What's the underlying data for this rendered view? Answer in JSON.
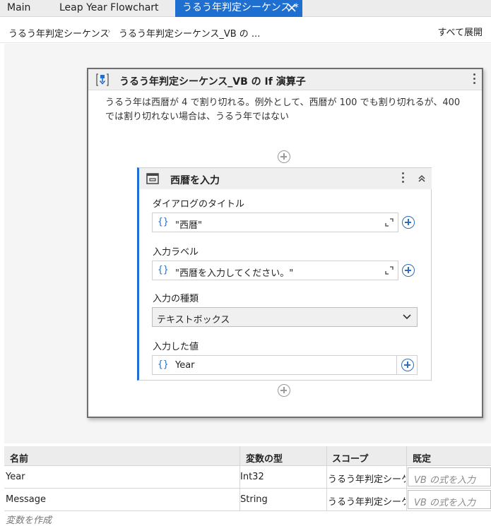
{
  "tabs": [
    {
      "label": "Main",
      "active": false
    },
    {
      "label": "Leap Year Flowchart",
      "active": false
    },
    {
      "label": "うるう年判定シーケンス *",
      "active": true
    }
  ],
  "breadcrumb": {
    "items": [
      "うるう年判定シーケンス",
      "うるう年判定シーケンス_VB の ..."
    ],
    "expand_all": "すべて展開"
  },
  "if_activity": {
    "title": "うるう年判定シーケンス_VB の If 演算子",
    "description": "うるう年は西暦が 4 で割り切れる。例外として、西暦が 100 でも割り切れるが、400 では割り切れない場合は、うるう年ではない"
  },
  "input_dialog": {
    "title": "西暦を入力",
    "fields": {
      "dialog_title_label": "ダイアログのタイトル",
      "dialog_title_value": "\"西暦\"",
      "input_label_label": "入力ラベル",
      "input_label_value": "\"西暦を入力してください。\"",
      "input_type_label": "入力の種類",
      "input_type_value": "テキストボックス",
      "input_value_label": "入力した値",
      "input_value_value": "Year"
    }
  },
  "variables": {
    "headers": [
      "名前",
      "変数の型",
      "スコープ",
      "既定"
    ],
    "rows": [
      {
        "name": "Year",
        "type": "Int32",
        "scope": "うるう年判定シーケ",
        "default_placeholder": "VB の式を入力"
      },
      {
        "name": "Message",
        "type": "String",
        "scope": "うるう年判定シーケ",
        "default_placeholder": "VB の式を入力"
      }
    ],
    "create": "変数を作成"
  },
  "colors": {
    "accent": "#1f6fd1",
    "link": "#2d6fb9"
  }
}
